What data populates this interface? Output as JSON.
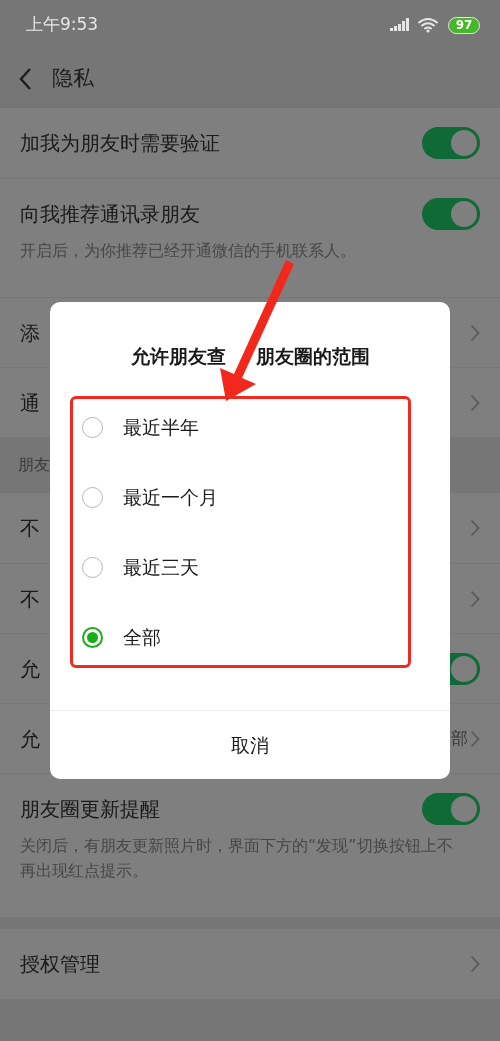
{
  "status_bar": {
    "time": "上午9:53",
    "battery": "97"
  },
  "header": {
    "title": "隐私"
  },
  "groups": [
    {
      "rows": [
        {
          "kind": "toggle",
          "label": "加我为朋友时需要验证",
          "on": true
        },
        {
          "kind": "toggle",
          "label": "向我推荐通讯录朋友",
          "on": true,
          "note": "开启后，为你推荐已经开通微信的手机联系人。"
        },
        {
          "kind": "link",
          "label": "添"
        },
        {
          "kind": "link",
          "label": "通"
        }
      ]
    },
    {
      "header": "朋友",
      "rows": [
        {
          "kind": "link",
          "label": "不"
        },
        {
          "kind": "link",
          "label": "不"
        },
        {
          "kind": "toggle",
          "label": "允",
          "on": true
        },
        {
          "kind": "link",
          "label": "允",
          "value": "部"
        },
        {
          "kind": "toggle",
          "label": "朋友圈更新提醒",
          "on": true,
          "note": "关闭后，有朋友更新照片时，界面下方的“发现”切换按钮上不再出现红点提示。"
        }
      ]
    },
    {
      "rows": [
        {
          "kind": "link",
          "label": "授权管理"
        }
      ]
    }
  ],
  "dialog": {
    "title_parts": [
      "允许朋友查",
      "朋友圈的范围"
    ],
    "options": [
      {
        "label": "最近半年",
        "selected": false
      },
      {
        "label": "最近一个月",
        "selected": false
      },
      {
        "label": "最近三天",
        "selected": false
      },
      {
        "label": "全部",
        "selected": true
      }
    ],
    "cancel": "取消"
  }
}
